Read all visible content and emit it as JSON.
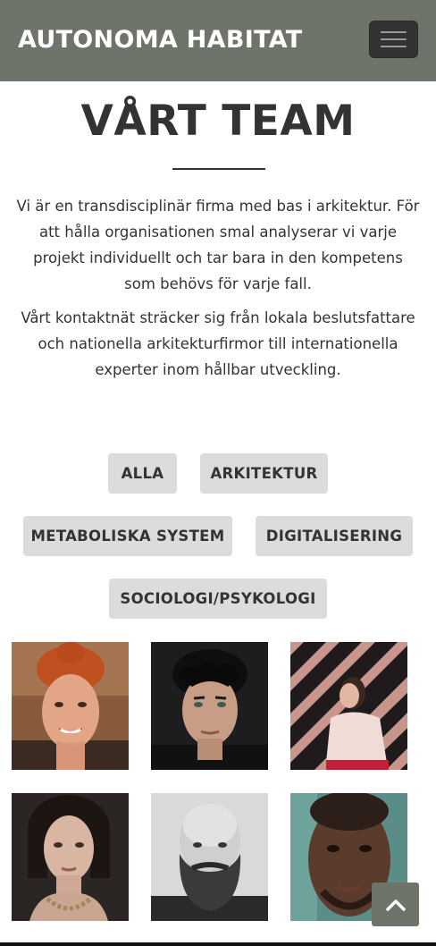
{
  "header": {
    "brand": "AUTONOMA HABITAT",
    "menu_icon": "hamburger-menu-icon",
    "background": "#6e7469"
  },
  "main": {
    "title": "VÅRT TEAM",
    "paragraphs": [
      "Vi är en transdisciplinär firma med bas i arkitektur. För att hålla organisationen smal analyserar vi varje projekt individuellt och tar bara in den kompetens som behövs för varje fall.",
      "Vårt kontaktnät sträcker sig från lokala beslutsfattare och nationella arkitekturfirmor till internationella experter inom hållbar utveckling."
    ]
  },
  "filters": {
    "all": "ALLA",
    "architecture": "ARKITEKTUR",
    "metabolic": "METABOLISKA SYSTEM",
    "digital": "DIGITALISERING",
    "sociology": "SOCIOLOGI/PSYKOLOGI"
  },
  "team_photos": [
    "woman-red-hair-smiling",
    "young-man-dark-curly-hair",
    "woman-pink-sweater-striped-wall",
    "woman-dark-bob-necklace",
    "bald-man-beard-bw",
    "man-portrait-teal-light"
  ],
  "scroll_top_icon": "chevron-up-icon"
}
